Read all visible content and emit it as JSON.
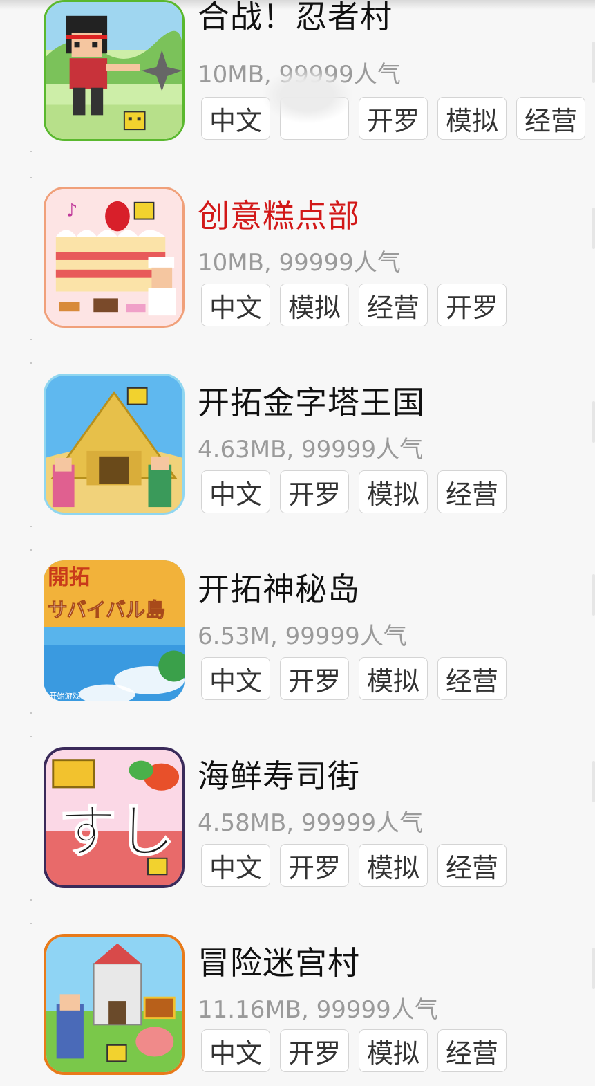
{
  "apps": [
    {
      "icon": "ninja-village-icon",
      "title": "合战！忍者村",
      "meta": "10MB, 99999人气",
      "title_color": "#111111",
      "tags": [
        "中文",
        "",
        "开罗",
        "模拟",
        "经营"
      ]
    },
    {
      "icon": "cake-shop-icon",
      "title": "创意糕点部",
      "meta": "10MB, 99999人气",
      "title_color": "#d21818",
      "tags": [
        "中文",
        "模拟",
        "经营",
        "开罗"
      ]
    },
    {
      "icon": "pyramid-icon",
      "title": "开拓金字塔王国",
      "meta": "4.63MB, 99999人气",
      "title_color": "#111111",
      "tags": [
        "中文",
        "开罗",
        "模拟",
        "经营"
      ]
    },
    {
      "icon": "island-icon",
      "title": "开拓神秘岛",
      "meta": "6.53M, 99999人气",
      "title_color": "#111111",
      "tags": [
        "中文",
        "开罗",
        "模拟",
        "经营"
      ]
    },
    {
      "icon": "sushi-icon",
      "title": "海鲜寿司街",
      "meta": "4.58MB, 99999人气",
      "title_color": "#111111",
      "tags": [
        "中文",
        "开罗",
        "模拟",
        "经营"
      ]
    },
    {
      "icon": "dungeon-village-icon",
      "title": "冒险迷宫村",
      "meta": "11.16MB, 99999人气",
      "title_color": "#111111",
      "tags": [
        "中文",
        "开罗",
        "模拟",
        "经营"
      ]
    }
  ],
  "icon_texts": {
    "island_logo": "開拓",
    "island_sub": "サバイバル島",
    "island_start": "开始游戏",
    "sushi_glyph": "すし"
  }
}
